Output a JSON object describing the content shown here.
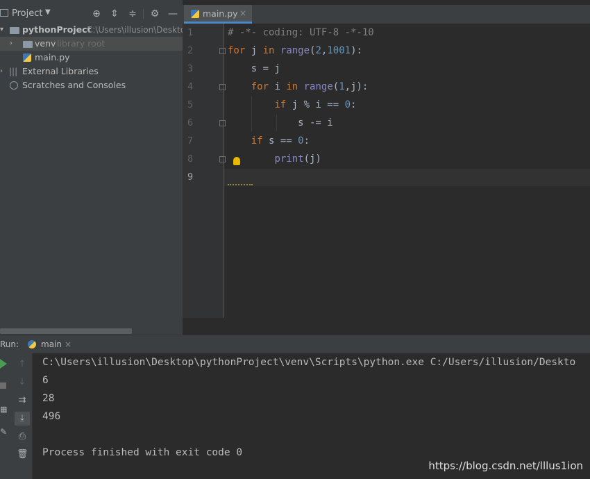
{
  "project": {
    "header_label": "Project",
    "tree": [
      {
        "label": "pythonProject",
        "detail": "C:\\Users\\illusion\\Deskto"
      },
      {
        "label": "venv",
        "detail": "library root"
      },
      {
        "label": "main.py"
      },
      {
        "label": "External Libraries"
      },
      {
        "label": "Scratches and Consoles"
      }
    ]
  },
  "editor": {
    "tab_label": "main.py",
    "tab_close": "×",
    "line_numbers": [
      "1",
      "2",
      "3",
      "4",
      "5",
      "6",
      "7",
      "8",
      "9"
    ]
  },
  "run": {
    "label": "Run:",
    "config_name": "main",
    "close": "×",
    "output": [
      "C:\\Users\\illusion\\Desktop\\pythonProject\\venv\\Scripts\\python.exe C:/Users/illusion/Deskto",
      "6",
      "28",
      "496",
      "",
      "Process finished with exit code 0"
    ]
  },
  "watermark": "https://blog.csdn.net/lllus1ion",
  "colors": {
    "keyword": "#cc7832",
    "number": "#6897bb",
    "builtin": "#8888c6",
    "comment": "#808080"
  }
}
